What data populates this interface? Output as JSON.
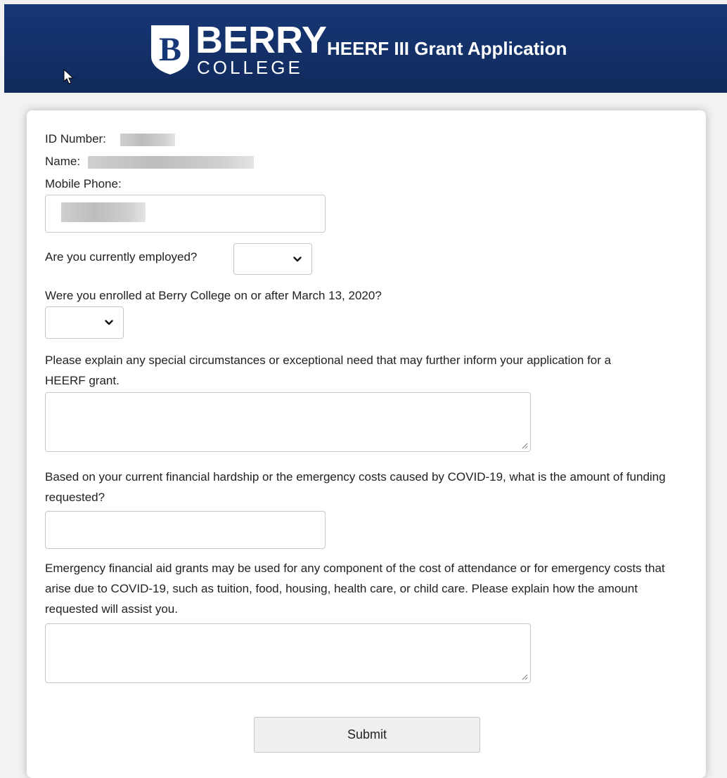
{
  "header": {
    "logo_letter": "B",
    "logo_word": "BERRY",
    "logo_sub": "COLLEGE",
    "title": "HEERF III Grant Application",
    "bar_color": "#163776"
  },
  "form": {
    "id_label": "ID Number:",
    "name_label": "Name:",
    "phone_label": "Mobile Phone:",
    "employed_question": "Are you currently employed?",
    "employed_value": "",
    "enrolled_question": "Were you enrolled at Berry College on or after March 13, 2020?",
    "enrolled_value": "",
    "circumstances_question": "Please explain any special circumstances or exceptional need that may further inform your application for a HEERF grant.",
    "circumstances_value": "",
    "amount_question": "Based on your current financial hardship or the emergency costs caused by COVID-19, what is the amount of funding requested?",
    "amount_value": "",
    "assist_question": "Emergency financial aid grants may be used for any component of the cost of attendance or for emergency costs that arise due to COVID-19, such as tuition, food, housing, health care, or child care. Please explain how the amount requested will assist you.",
    "assist_value": "",
    "submit_label": "Submit"
  },
  "icons": {
    "cursor": "mouse-pointer-icon",
    "select_arrow": "chevron-down-icon",
    "resize": "resize-grip-icon"
  }
}
